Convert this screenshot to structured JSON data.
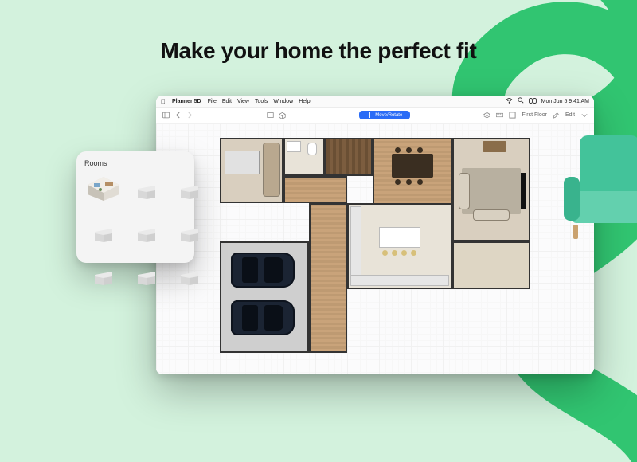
{
  "headline": "Make your home the perfect fit",
  "menubar": {
    "app_name": "Planner 5D",
    "items": [
      "File",
      "Edit",
      "View",
      "Tools",
      "Window",
      "Help"
    ],
    "clock": "Mon Jun 5  9:41 AM"
  },
  "toolbar": {
    "blue_pill_label": "Move/Rotate",
    "first_floor_label": "First Floor",
    "edit_label": "Edit"
  },
  "panel": {
    "title": "Rooms"
  },
  "colors": {
    "accent_green": "#38c97a",
    "accent_blue": "#2a6cf6"
  }
}
